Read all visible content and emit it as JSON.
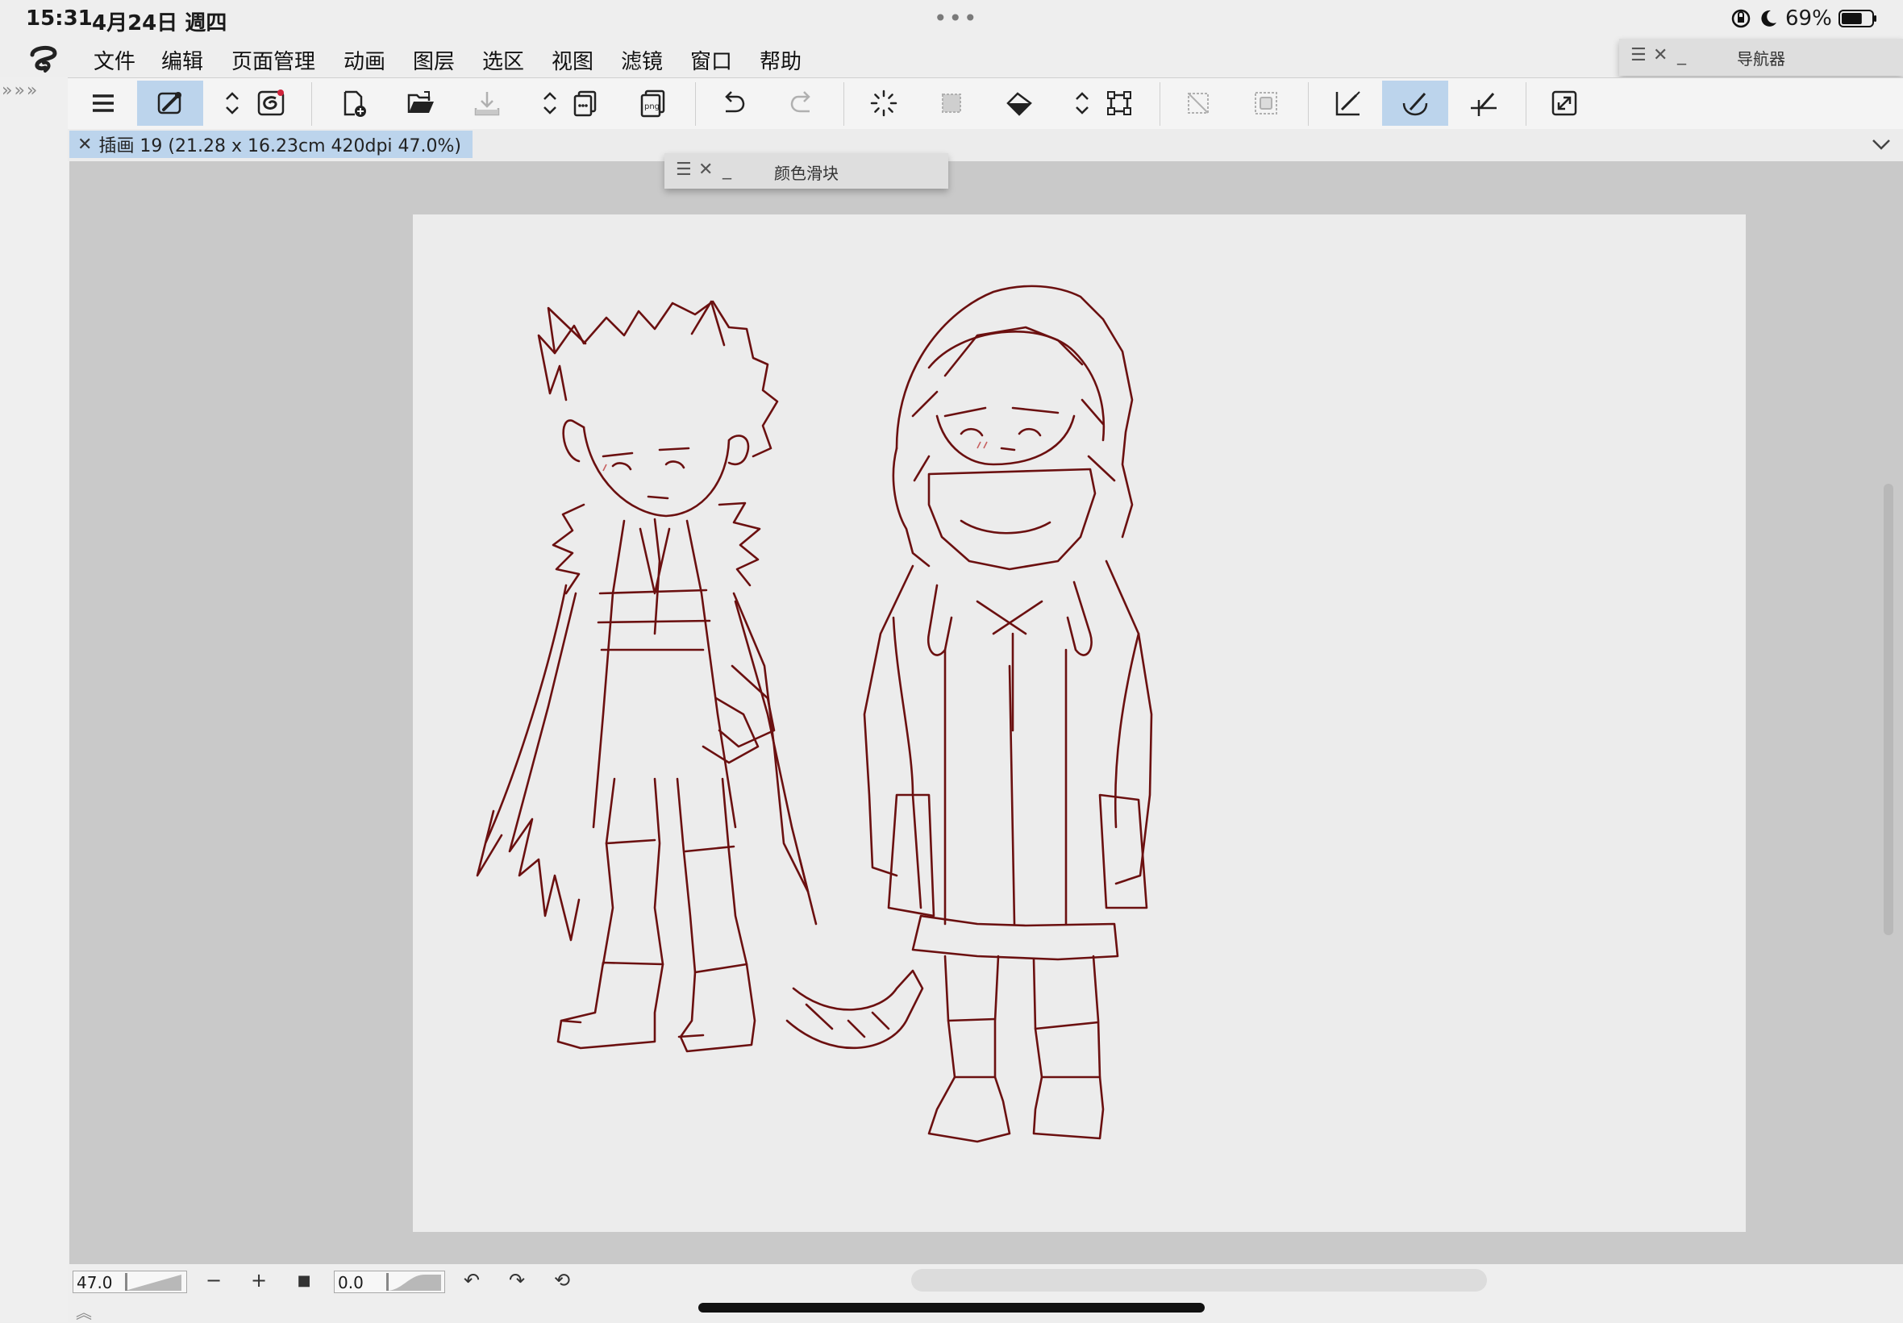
{
  "status_bar": {
    "time": "15:31",
    "date": "4月24日 週四",
    "dots": "•••",
    "battery_percent": "69%",
    "battery_level": 0.69
  },
  "menu": {
    "items": [
      "文件",
      "编辑",
      "页面管理",
      "动画",
      "图层",
      "选区",
      "视图",
      "滤镜",
      "窗口",
      "帮助"
    ]
  },
  "navigator_panel": {
    "title": "导航器"
  },
  "color_slider_panel": {
    "title": "颜色滑块"
  },
  "left_strip": {
    "arrows": "»»»"
  },
  "toolbar": {
    "icons": [
      "hamburger-menu-icon",
      "clip-studio-connect-icon",
      "updown-chevron-icon",
      "companion-mode-icon",
      "new-canvas-icon",
      "open-folder-icon",
      "save-icon",
      "updown-chevron-icon",
      "copy-layers-icon",
      "export-png-icon",
      "undo-icon",
      "redo-icon",
      "loading-spinner-icon",
      "clear-selection-icon",
      "fill-bucket-icon",
      "updown-chevron-icon",
      "transform-icon",
      "clear-outside-icon",
      "deselect-icon",
      "snap-ruler-icon",
      "snap-special-ruler-icon",
      "snap-grid-icon",
      "fullscreen-icon"
    ],
    "png_label": "png"
  },
  "tab": {
    "close": "✕",
    "title": "插画 19 (21.28 x 16.23cm 420dpi 47.0%)"
  },
  "bottom_bar": {
    "zoom_value": "47.0",
    "zoom_out": "−",
    "zoom_in": "+",
    "fit": "■",
    "rotation_value": "0.0",
    "rotate_left": "↶",
    "rotate_right": "↷",
    "reset_rotation": "⟲",
    "expand": "︽"
  },
  "colors": {
    "accent": "#bcd4ec",
    "canvas_bg": "#c9c9c9",
    "paper": "#ececec",
    "line_art": "#6b1010"
  }
}
